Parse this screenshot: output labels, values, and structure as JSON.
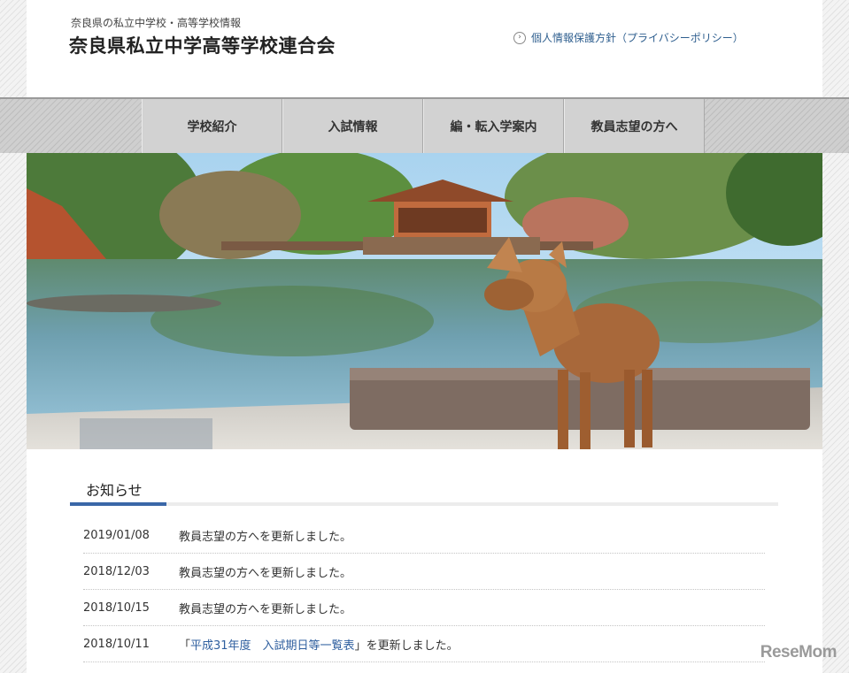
{
  "header": {
    "subtitle": "奈良県の私立中学校・高等学校情報",
    "title": "奈良県私立中学高等学校連合会",
    "privacy_link": "個人情報保護方針（プライバシーポリシー）"
  },
  "nav": {
    "items": [
      {
        "label": "学校紹介"
      },
      {
        "label": "入試情報"
      },
      {
        "label": "編・転入学案内"
      },
      {
        "label": "教員志望の方へ"
      }
    ]
  },
  "hero": {
    "description_icon": "deer-pond-photo"
  },
  "news": {
    "heading": "お知らせ",
    "items": [
      {
        "date": "2019/01/08",
        "text": "教員志望の方へを更新しました。"
      },
      {
        "date": "2018/12/03",
        "text": "教員志望の方へを更新しました。"
      },
      {
        "date": "2018/10/15",
        "text": "教員志望の方へを更新しました。"
      },
      {
        "date": "2018/10/11",
        "prefix": "「",
        "link": "平成31年度　入試期日等一覧表",
        "suffix": "」を更新しました。"
      }
    ]
  },
  "watermark": "ReseMom",
  "colors": {
    "accent": "#3a67a7",
    "link": "#2f5f9f",
    "nav_bg": "#d2d2d2"
  }
}
